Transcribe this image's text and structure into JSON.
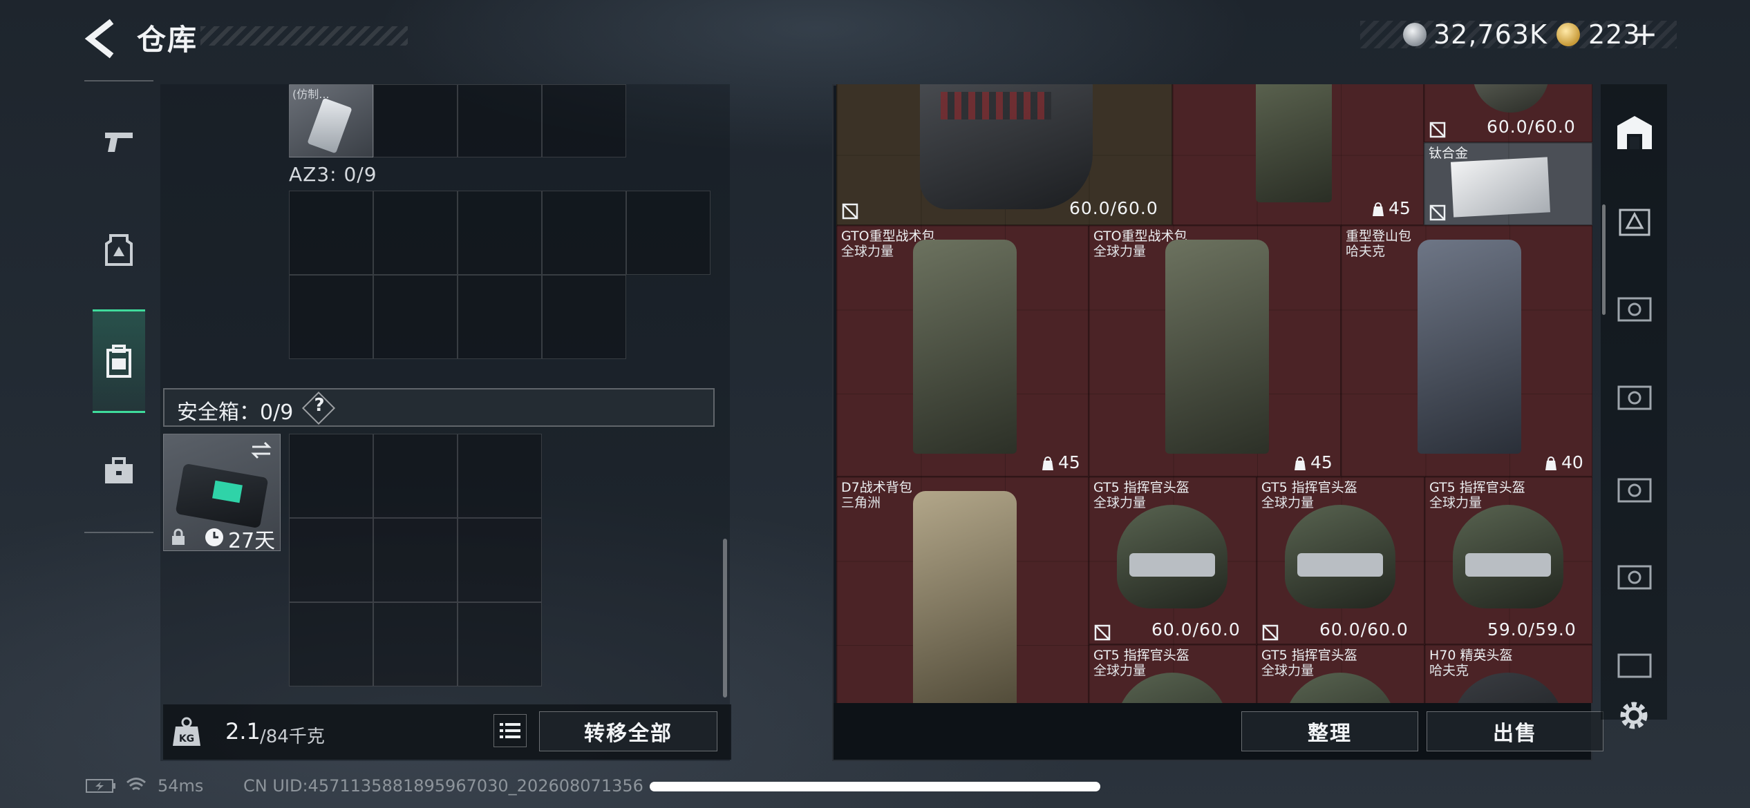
{
  "header": {
    "title": "仓库",
    "currency_primary": "32,763K",
    "currency_secondary": "223",
    "plus": "+"
  },
  "left": {
    "az3_label": "AZ3: 0/9",
    "item_small_label": "(仿制...",
    "safe_label": "安全箱：0/9",
    "help": "?",
    "case_days": "27天"
  },
  "weight": {
    "current": "2.1",
    "max": "/84千克",
    "kg_badge": "KG"
  },
  "buttons": {
    "transfer_all": "转移全部",
    "organize": "整理",
    "sell": "出售"
  },
  "stash": {
    "top_row": {
      "vest_durability": "60.0/60.0",
      "pack_capacity": "45",
      "top_right_durability": "60.0/60.0",
      "metal_name": "钛合金"
    },
    "row2": [
      {
        "name": "GTO重型战术包",
        "sub": "全球力量",
        "capacity": "45"
      },
      {
        "name": "GTO重型战术包",
        "sub": "全球力量",
        "capacity": "45"
      },
      {
        "name": "重型登山包",
        "sub": "哈夫克",
        "capacity": "40"
      }
    ],
    "row3": [
      {
        "name": "D7战术背包",
        "sub": "三角洲"
      },
      {
        "name": "GT5 指挥官头盔",
        "sub": "全球力量",
        "durability": "60.0/60.0"
      },
      {
        "name": "GT5 指挥官头盔",
        "sub": "全球力量",
        "durability": "60.0/60.0"
      },
      {
        "name": "GT5 指挥官头盔",
        "sub": "全球力量",
        "durability": "59.0/59.0"
      }
    ],
    "row4": [
      {
        "name": "GT5 指挥官头盔",
        "sub": "全球力量"
      },
      {
        "name": "GT5 指挥官头盔",
        "sub": "全球力量"
      },
      {
        "name": "H70 精英头盔",
        "sub": "哈夫克"
      }
    ]
  },
  "footer": {
    "ping": "54ms",
    "uid": "CN UID:4571135881895967030_202608071356"
  },
  "colors": {
    "accent": "#3fdc9c",
    "cell_bg": "#4b2326"
  },
  "icons": {
    "back": "back-arrow-icon",
    "weapon_tab": "pistol-icon",
    "armor_tab": "armor-icon",
    "backpack_tab": "backpack-icon",
    "case_tab": "briefcase-icon",
    "settings": "gear-icon"
  }
}
